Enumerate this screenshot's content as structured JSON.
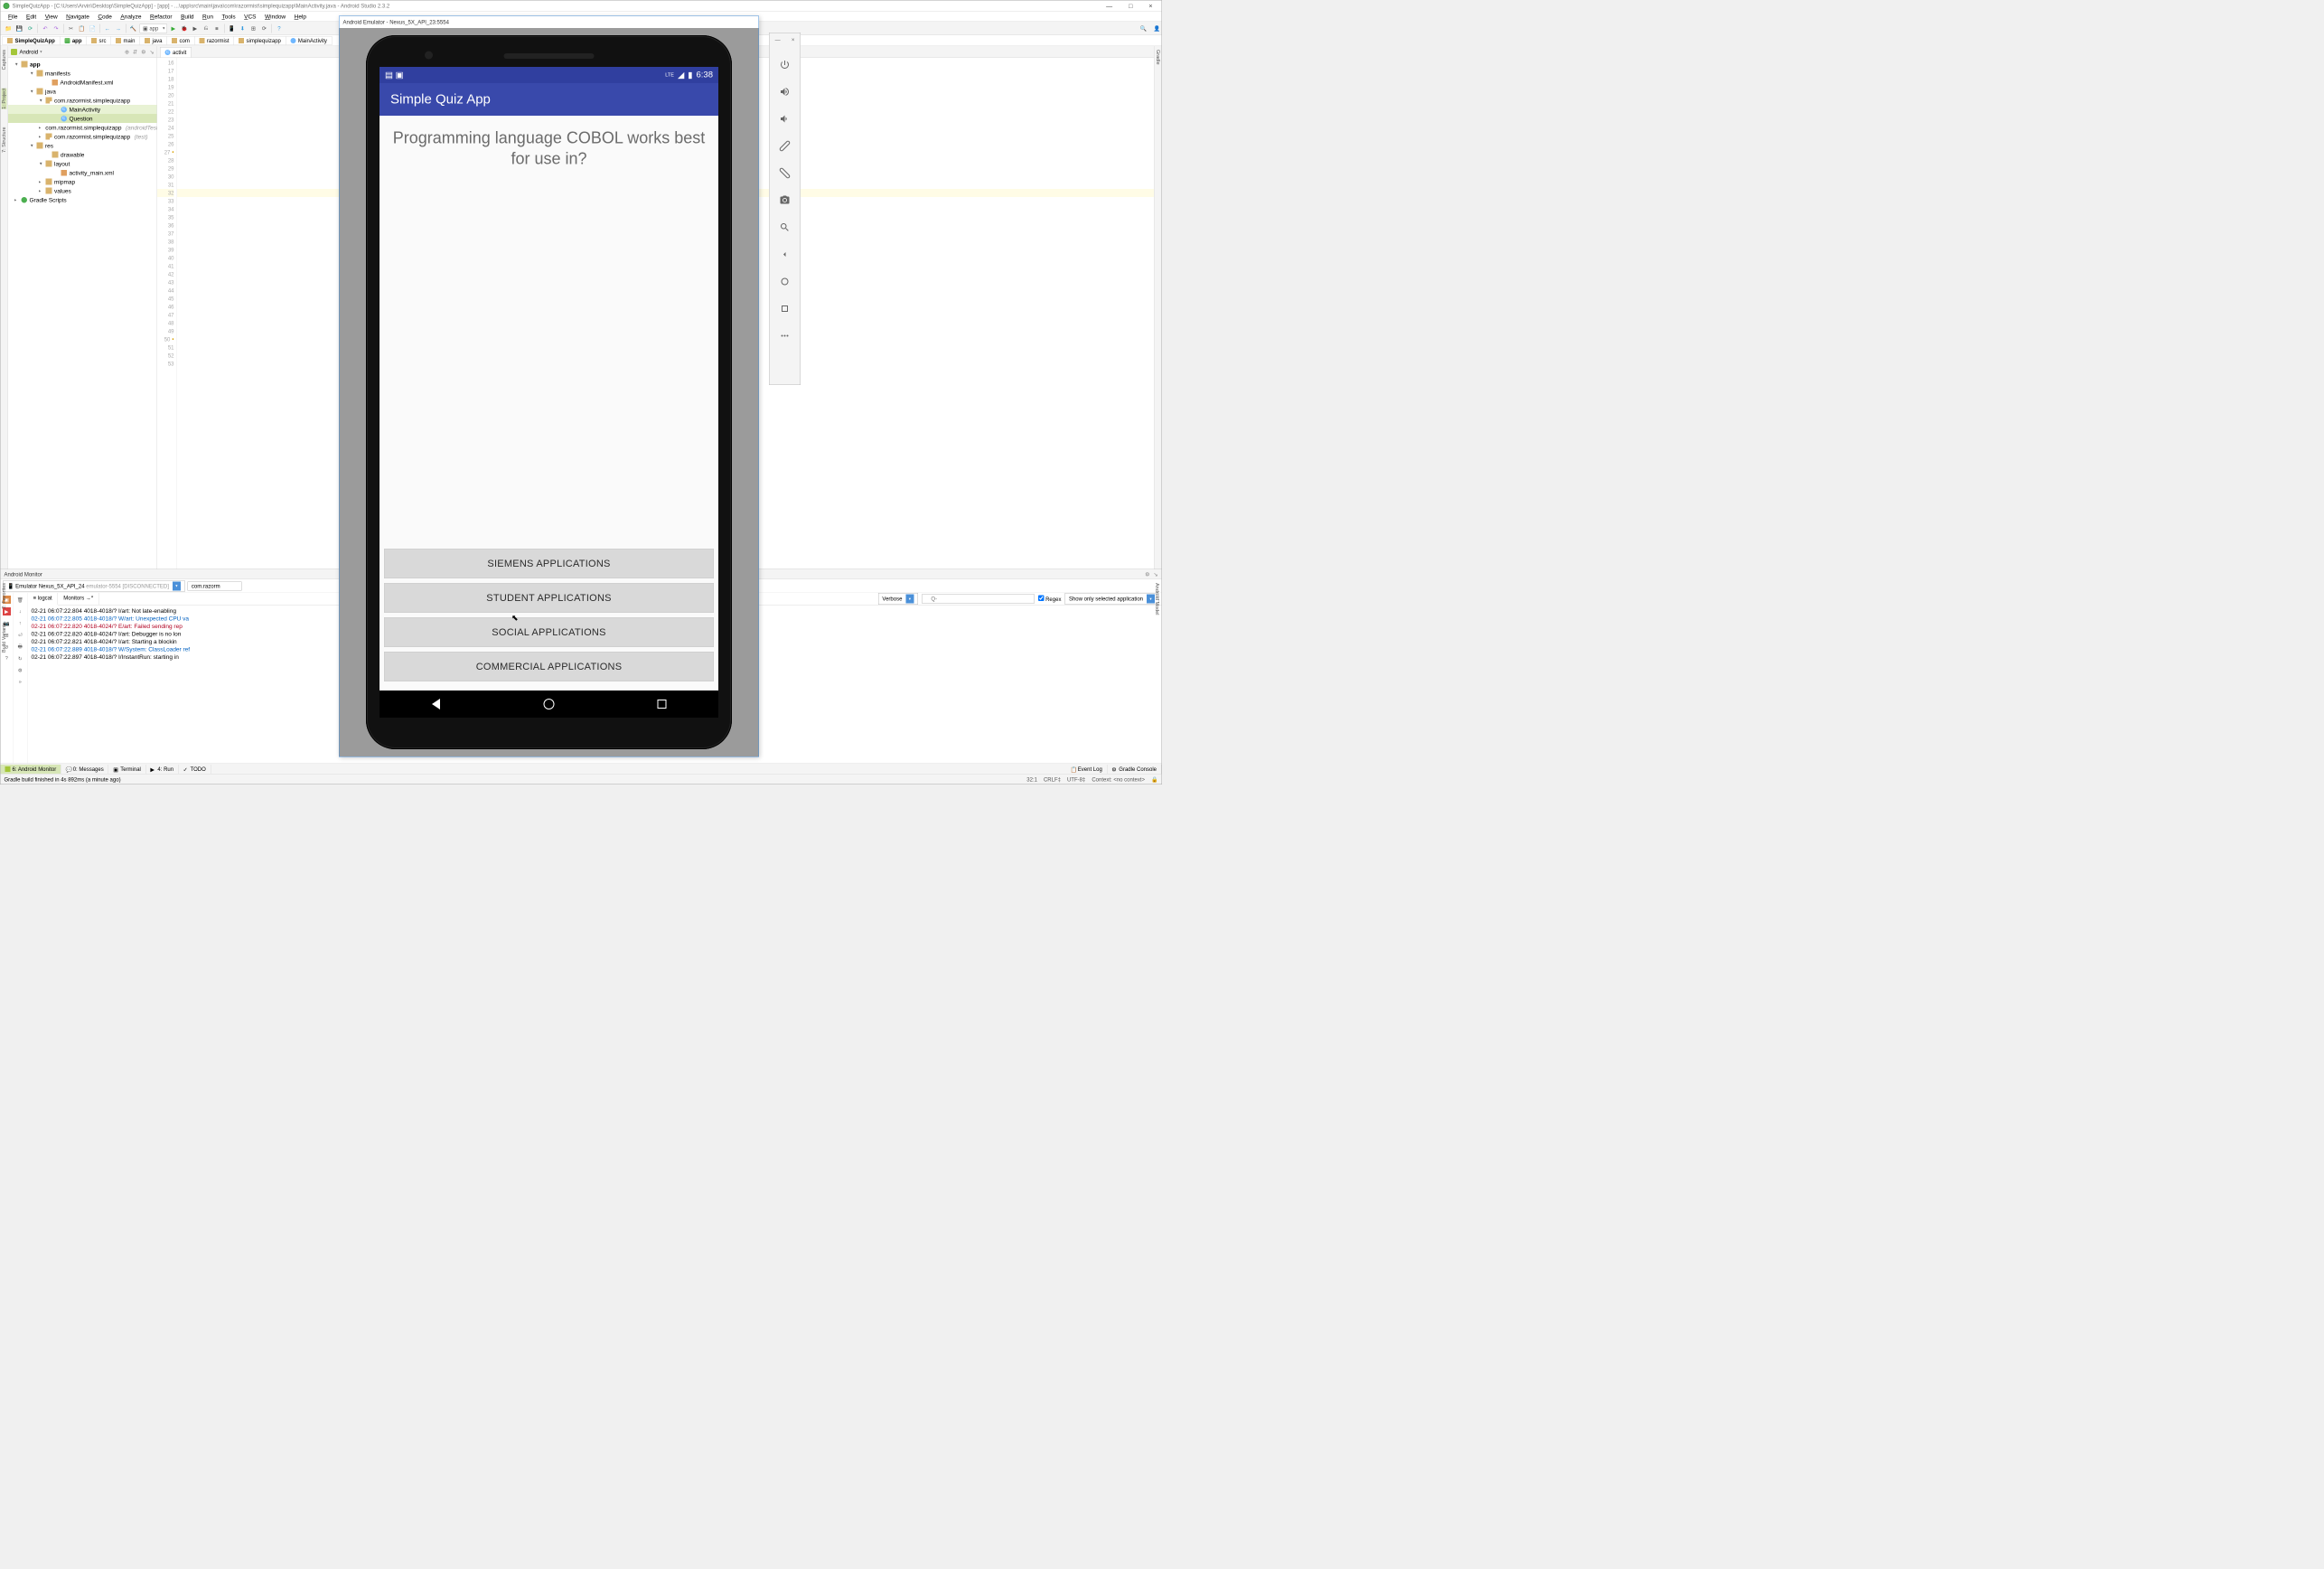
{
  "window": {
    "title": "SimpleQuizApp - [C:\\Users\\Arvin\\Desktop\\SimpleQuizApp] - [app] - ...\\app\\src\\main\\java\\com\\razormist\\simplequizapp\\MainActivity.java - Android Studio 2.3.2",
    "minimize": "—",
    "maximize": "□",
    "close": "×"
  },
  "menu": [
    "File",
    "Edit",
    "View",
    "Navigate",
    "Code",
    "Analyze",
    "Refactor",
    "Build",
    "Run",
    "Tools",
    "VCS",
    "Window",
    "Help"
  ],
  "toolbar": {
    "run_config": "app"
  },
  "breadcrumbs": [
    "SimpleQuizApp",
    "app",
    "src",
    "main",
    "java",
    "com",
    "razormist",
    "simplequizapp",
    "MainActivity"
  ],
  "project": {
    "mode": "Android",
    "tree": {
      "app": "app",
      "manifests": "manifests",
      "manifest_file": "AndroidManifest.xml",
      "java": "java",
      "pkg1": "com.razormist.simplequizapp",
      "main_activity": "MainActivity",
      "question": "Question",
      "pkg_test1": "com.razormist.simplequizapp",
      "pkg_test1_suffix": "(androidTest)",
      "pkg_test2": "com.razormist.simplequizapp",
      "pkg_test2_suffix": "(test)",
      "res": "res",
      "drawable": "drawable",
      "layout": "layout",
      "layout_file": "activity_main.xml",
      "mipmap": "mipmap",
      "values": "values",
      "gradle": "Gradle Scripts"
    }
  },
  "editor": {
    "tab_main": "activit",
    "lines_start": 16,
    "lines_end": 53
  },
  "monitor": {
    "title": "Android Monitor",
    "device": "Emulator Nexus_5X_API_24",
    "device_suffix": "emulator-5554 [DISCONNECTED]",
    "process": "com.razorm",
    "tab_logcat": "logcat",
    "tab_monitors": "Monitors",
    "loglevel": "Verbose",
    "search_placeholder": "Q-",
    "regex_label": "Regex",
    "filter": "Show only selected application",
    "log1": "02-21 06:07:22.804 4018-4018/? I/art: Not late-enabling",
    "log2": "02-21 06:07:22.805 4018-4018/? W/art: Unexpected CPU va",
    "log3": "02-21 06:07:22.820 4018-4024/? E/art: Failed sending rep",
    "log4": "02-21 06:07:22.820 4018-4024/? I/art: Debugger is no lon",
    "log5": "02-21 06:07:22.821 4018-4024/? I/art: Starting a blockin",
    "log6": "02-21 06:07:22.889 4018-4018/? W/System: ClassLoader ref",
    "log7": "02-21 06:07:22.897 4018-4018/? I/InstantRun: starting in"
  },
  "bottom_tabs": {
    "monitor": "6: Android Monitor",
    "messages": "0: Messages",
    "terminal": "Terminal",
    "run": "4: Run",
    "todo": "TODO",
    "eventlog": "Event Log",
    "gradlecon": "Gradle Console"
  },
  "status": {
    "msg": "Gradle build finished in 4s 892ms (a minute ago)",
    "pos": "32:1",
    "eol": "CRLF‡",
    "enc": "UTF-8‡",
    "ctx": "Context: <no context>"
  },
  "left_gutter": [
    "Captures",
    "1: Project",
    "7: Structure"
  ],
  "left_gutter2": [
    "2: Favorites",
    "Build Variants"
  ],
  "right_gutter": "Gradle",
  "right_gutter2": "Android Model",
  "emulator": {
    "title": "Android Emulator - Nexus_5X_API_23:5554",
    "status_time": "6:38",
    "status_net": "LTE",
    "app_title": "Simple Quiz App",
    "question": "Programming language COBOL works best for use in?",
    "answers": [
      "SIEMENS APPLICATIONS",
      "STUDENT APPLICATIONS",
      "SOCIAL APPLICATIONS",
      "COMMERCIAL APPLICATIONS"
    ],
    "panel_min": "—",
    "panel_close": "×"
  }
}
